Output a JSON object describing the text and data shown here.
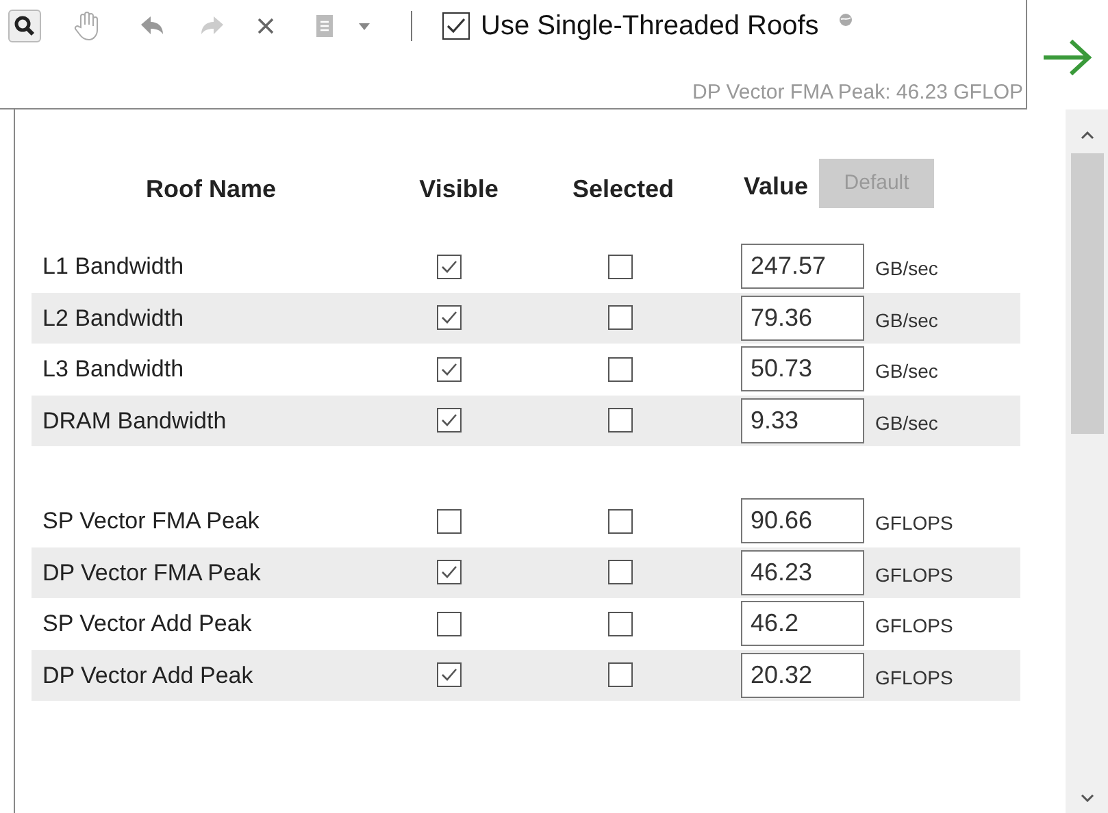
{
  "toolbar": {
    "use_single_threaded": {
      "label": "Use Single-Threaded Roofs",
      "checked": true
    },
    "tooltip": "DP Vector FMA Peak: 46.23 GFLOP"
  },
  "table": {
    "columns": [
      "Roof Name",
      "Visible",
      "Selected",
      "Value"
    ],
    "default_button": {
      "label": "Default",
      "disabled": true
    },
    "groups": [
      {
        "rows": [
          {
            "name": "L1 Bandwidth",
            "visible": true,
            "selected": false,
            "value": "247.57",
            "unit": "GB/sec"
          },
          {
            "name": "L2 Bandwidth",
            "visible": true,
            "selected": false,
            "value": "79.36",
            "unit": "GB/sec"
          },
          {
            "name": "L3 Bandwidth",
            "visible": true,
            "selected": false,
            "value": "50.73",
            "unit": "GB/sec"
          },
          {
            "name": "DRAM Bandwidth",
            "visible": true,
            "selected": false,
            "value": "9.33",
            "unit": "GB/sec"
          }
        ]
      },
      {
        "rows": [
          {
            "name": "SP Vector FMA Peak",
            "visible": false,
            "selected": false,
            "value": "90.66",
            "unit": "GFLOPS"
          },
          {
            "name": "DP Vector FMA Peak",
            "visible": true,
            "selected": false,
            "value": "46.23",
            "unit": "GFLOPS"
          },
          {
            "name": "SP Vector Add Peak",
            "visible": false,
            "selected": false,
            "value": "46.2",
            "unit": "GFLOPS"
          },
          {
            "name": "DP Vector Add Peak",
            "visible": true,
            "selected": false,
            "value": "20.32",
            "unit": "GFLOPS"
          }
        ]
      }
    ]
  }
}
